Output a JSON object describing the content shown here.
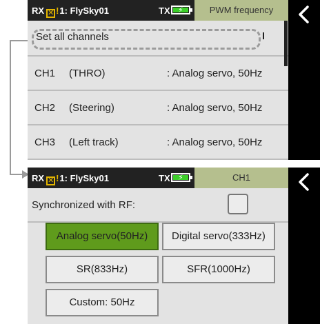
{
  "status": {
    "rx": "RX",
    "rx_warn": "!",
    "model": "1: FlySky01",
    "tx": "TX"
  },
  "top_screen": {
    "title": "PWM frequency",
    "set_all": "Set all channels",
    "channels": [
      {
        "ch": "CH1",
        "name": "(THRO)",
        "value": ": Analog servo, 50Hz"
      },
      {
        "ch": "CH2",
        "name": "(Steering)",
        "value": ": Analog servo, 50Hz"
      },
      {
        "ch": "CH3",
        "name": "(Left track)",
        "value": ": Analog servo, 50Hz"
      }
    ]
  },
  "bottom_screen": {
    "title": "CH1",
    "sync_label": "Synchronized with RF:",
    "options": {
      "analog": "Analog servo(50Hz)",
      "digital": "Digital servo(333Hz)",
      "sr": "SR(833Hz)",
      "sfr": "SFR(1000Hz)",
      "custom": "Custom: 50Hz"
    },
    "selected": "Analog servo(50Hz)"
  },
  "colors": {
    "selected_option": "#5f9b1c",
    "title_chip": "#b5bf8e",
    "battery": "#3dcf2a",
    "warning": "#e3b500"
  },
  "icons": {
    "back": "chevron-left-icon",
    "battery": "battery-charging-icon",
    "rx_status": "x-box-icon"
  }
}
